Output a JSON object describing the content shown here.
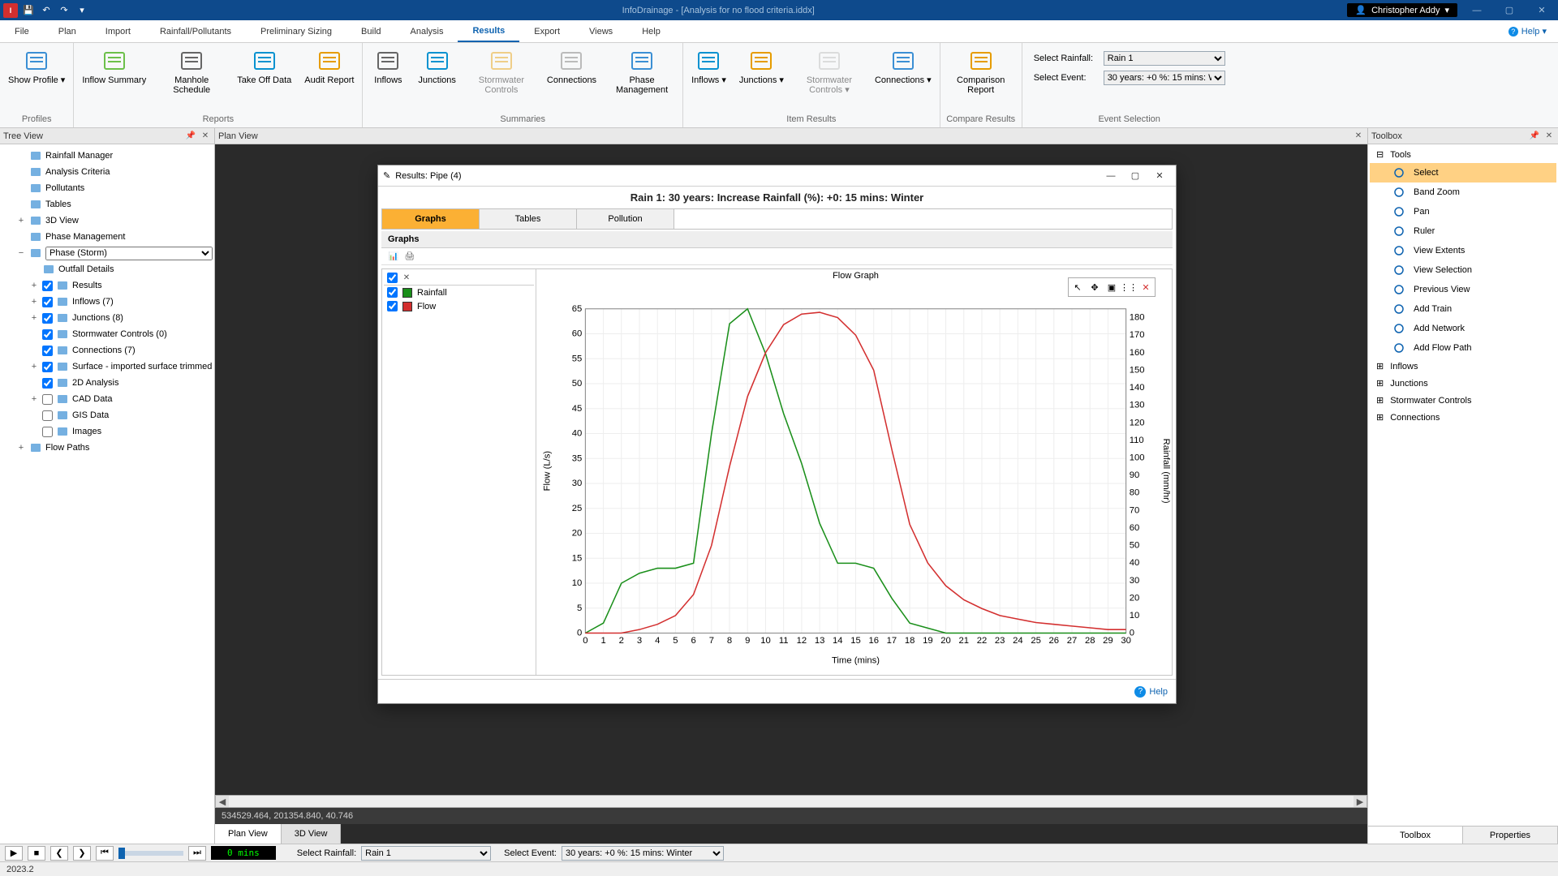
{
  "window": {
    "title": "InfoDrainage - [Analysis for no flood criteria.iddx]",
    "user": "Christopher Addy"
  },
  "menu": [
    "File",
    "Plan",
    "Import",
    "Rainfall/Pollutants",
    "Preliminary Sizing",
    "Build",
    "Analysis",
    "Results",
    "Export",
    "Views",
    "Help"
  ],
  "menu_active": "Results",
  "help_label": "Help",
  "ribbon": {
    "groups": [
      {
        "caption": "Profiles",
        "items": [
          {
            "label": "Show Profile ▾"
          }
        ]
      },
      {
        "caption": "Reports",
        "items": [
          {
            "label": "Inflow Summary"
          },
          {
            "label": "Manhole Schedule"
          },
          {
            "label": "Take Off Data"
          },
          {
            "label": "Audit Report"
          }
        ]
      },
      {
        "caption": "Summaries",
        "items": [
          {
            "label": "Inflows"
          },
          {
            "label": "Junctions"
          },
          {
            "label": "Stormwater Controls",
            "disabled": true
          },
          {
            "label": "Connections"
          },
          {
            "label": "Phase Management"
          }
        ]
      },
      {
        "caption": "Item Results",
        "items": [
          {
            "label": "Inflows ▾"
          },
          {
            "label": "Junctions ▾"
          },
          {
            "label": "Stormwater Controls ▾",
            "disabled": true
          },
          {
            "label": "Connections ▾"
          }
        ]
      },
      {
        "caption": "Compare Results",
        "items": [
          {
            "label": "Comparison Report"
          }
        ]
      }
    ],
    "event_caption": "Event Selection",
    "select_rainfall_label": "Select Rainfall:",
    "select_event_label": "Select Event:",
    "select_rainfall_value": "Rain 1",
    "select_event_value": "30 years: +0 %: 15 mins: Winter"
  },
  "tree_header": "Tree View",
  "plan_header": "Plan View",
  "toolbox_header": "Toolbox",
  "tree": [
    {
      "label": "Rainfall Manager",
      "indent": 1
    },
    {
      "label": "Analysis Criteria",
      "indent": 1
    },
    {
      "label": "Pollutants",
      "indent": 1
    },
    {
      "label": "Tables",
      "indent": 1
    },
    {
      "label": "3D View",
      "indent": 1,
      "tgl": "+"
    },
    {
      "label": "Phase Management",
      "indent": 1
    },
    {
      "label": "Phase (Storm)",
      "indent": 1,
      "tgl": "−",
      "dropdown": true
    },
    {
      "label": "Outfall Details",
      "indent": 2
    },
    {
      "label": "Results",
      "indent": 2,
      "tgl": "+",
      "chk": true
    },
    {
      "label": "Inflows (7)",
      "indent": 2,
      "tgl": "+",
      "chk": true
    },
    {
      "label": "Junctions (8)",
      "indent": 2,
      "tgl": "+",
      "chk": true
    },
    {
      "label": "Stormwater Controls (0)",
      "indent": 2,
      "chk": true
    },
    {
      "label": "Connections (7)",
      "indent": 2,
      "chk": true
    },
    {
      "label": "Surface - imported surface trimmed",
      "indent": 2,
      "tgl": "+",
      "chk": true
    },
    {
      "label": "2D Analysis",
      "indent": 2,
      "chk": true
    },
    {
      "label": "CAD Data",
      "indent": 2,
      "tgl": "+",
      "chk": false
    },
    {
      "label": "GIS Data",
      "indent": 2,
      "chk": false
    },
    {
      "label": "Images",
      "indent": 2,
      "chk": false
    },
    {
      "label": "Flow Paths",
      "indent": 1,
      "tgl": "+"
    }
  ],
  "results_window": {
    "title": "Results: Pipe (4)",
    "caption": "Rain 1: 30 years: Increase Rainfall (%): +0: 15 mins: Winter",
    "tabs": [
      "Graphs",
      "Tables",
      "Pollution"
    ],
    "tab_active": "Graphs",
    "graphs_label": "Graphs",
    "chart_title": "Flow Graph",
    "legend": [
      {
        "name": "Rainfall",
        "color": "#1a8f1a"
      },
      {
        "name": "Flow",
        "color": "#d32f2f"
      }
    ],
    "help": "Help"
  },
  "chart_data": {
    "type": "line",
    "xlabel": "Time (mins)",
    "ylabel_left": "Flow (L/s)",
    "ylabel_right": "Rainfall (mm/hr)",
    "x": [
      0,
      1,
      2,
      3,
      4,
      5,
      6,
      7,
      8,
      9,
      10,
      11,
      12,
      13,
      14,
      15,
      16,
      17,
      18,
      19,
      20,
      21,
      22,
      23,
      24,
      25,
      26,
      27,
      28,
      29,
      30
    ],
    "ylim_left": [
      0,
      65
    ],
    "ylim_right": [
      0,
      185
    ],
    "series": [
      {
        "name": "Rainfall",
        "axis": "left",
        "color": "#1a8f1a",
        "values": [
          0,
          2,
          10,
          12,
          13,
          13,
          14,
          40,
          62,
          65,
          56,
          44,
          34,
          22,
          14,
          14,
          13,
          7,
          2,
          1,
          0,
          0,
          0,
          0,
          0,
          0,
          0,
          0,
          0,
          0,
          0
        ]
      },
      {
        "name": "Flow",
        "axis": "right",
        "color": "#d32f2f",
        "values": [
          0,
          0,
          0,
          2,
          5,
          10,
          22,
          50,
          95,
          135,
          160,
          176,
          182,
          183,
          180,
          170,
          150,
          105,
          62,
          40,
          27,
          19,
          14,
          10,
          8,
          6,
          5,
          4,
          3,
          2,
          2
        ]
      }
    ]
  },
  "coords": "534529.464, 201354.840, 40.746",
  "view_tabs": [
    "Plan View",
    "3D View"
  ],
  "toolbox": {
    "tools_label": "Tools",
    "items": [
      {
        "label": "Select",
        "sel": true
      },
      {
        "label": "Band Zoom"
      },
      {
        "label": "Pan"
      },
      {
        "label": "Ruler"
      },
      {
        "label": "View Extents"
      },
      {
        "label": "View Selection"
      },
      {
        "label": "Previous View"
      },
      {
        "label": "Add Train"
      },
      {
        "label": "Add Network"
      },
      {
        "label": "Add Flow Path"
      }
    ],
    "groups": [
      "Inflows",
      "Junctions",
      "Stormwater Controls",
      "Connections"
    ],
    "tabs": [
      "Toolbox",
      "Properties"
    ]
  },
  "playbar": {
    "time": "0 mins",
    "select_rainfall_label": "Select Rainfall:",
    "select_event_label": "Select Event:",
    "select_rainfall_value": "Rain 1",
    "select_event_value": "30 years: +0 %: 15 mins: Winter"
  },
  "status": "2023.2"
}
